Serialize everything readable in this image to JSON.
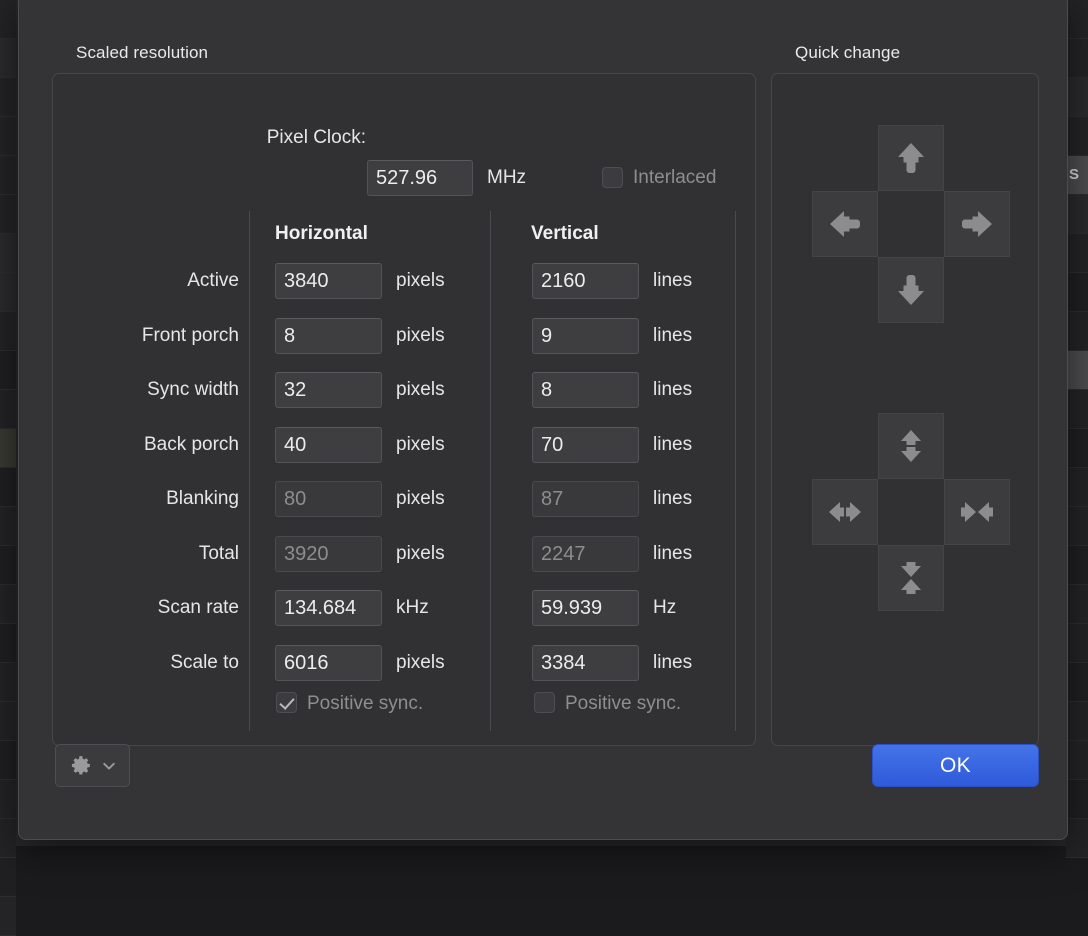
{
  "background": {
    "right_row_label": "S"
  },
  "scaled_resolution": {
    "title": "Scaled resolution",
    "pixel_clock": {
      "label": "Pixel Clock:",
      "value": "527.96",
      "unit": "MHz"
    },
    "interlaced": {
      "label": "Interlaced",
      "checked": false
    },
    "columns": {
      "horizontal": "Horizontal",
      "vertical": "Vertical"
    },
    "rows": [
      {
        "label": "Active",
        "h_value": "3840",
        "h_unit": "pixels",
        "h_dim": false,
        "v_value": "2160",
        "v_unit": "lines",
        "v_dim": false
      },
      {
        "label": "Front porch",
        "h_value": "8",
        "h_unit": "pixels",
        "h_dim": false,
        "v_value": "9",
        "v_unit": "lines",
        "v_dim": false
      },
      {
        "label": "Sync width",
        "h_value": "32",
        "h_unit": "pixels",
        "h_dim": false,
        "v_value": "8",
        "v_unit": "lines",
        "v_dim": false
      },
      {
        "label": "Back porch",
        "h_value": "40",
        "h_unit": "pixels",
        "h_dim": false,
        "v_value": "70",
        "v_unit": "lines",
        "v_dim": false
      },
      {
        "label": "Blanking",
        "h_value": "80",
        "h_unit": "pixels",
        "h_dim": true,
        "v_value": "87",
        "v_unit": "lines",
        "v_dim": true
      },
      {
        "label": "Total",
        "h_value": "3920",
        "h_unit": "pixels",
        "h_dim": true,
        "v_value": "2247",
        "v_unit": "lines",
        "v_dim": true
      },
      {
        "label": "Scan rate",
        "h_value": "134.684",
        "h_unit": "kHz",
        "h_dim": false,
        "v_value": "59.939",
        "v_unit": "Hz",
        "v_dim": false
      },
      {
        "label": "Scale to",
        "h_value": "6016",
        "h_unit": "pixels",
        "h_dim": false,
        "v_value": "3384",
        "v_unit": "lines",
        "v_dim": false
      }
    ],
    "sync": {
      "horizontal_label": "Positive sync.",
      "horizontal_checked": true,
      "vertical_label": "Positive sync.",
      "vertical_checked": false
    }
  },
  "quick_change": {
    "title": "Quick change",
    "move_pad": {
      "up": "move-up",
      "left": "move-left",
      "right": "move-right",
      "down": "move-down"
    },
    "size_pad": {
      "up": "stretch-vertical",
      "left": "stretch-horizontal",
      "right": "shrink-horizontal",
      "down": "shrink-vertical"
    }
  },
  "footer": {
    "gear_menu": "gear-menu",
    "ok_label": "OK"
  },
  "colors": {
    "accent": "#3b67e0",
    "dialog_bg": "#343437",
    "group_bg": "#313134",
    "text": "#e6e6e7",
    "dim_text": "#8d8d90"
  }
}
